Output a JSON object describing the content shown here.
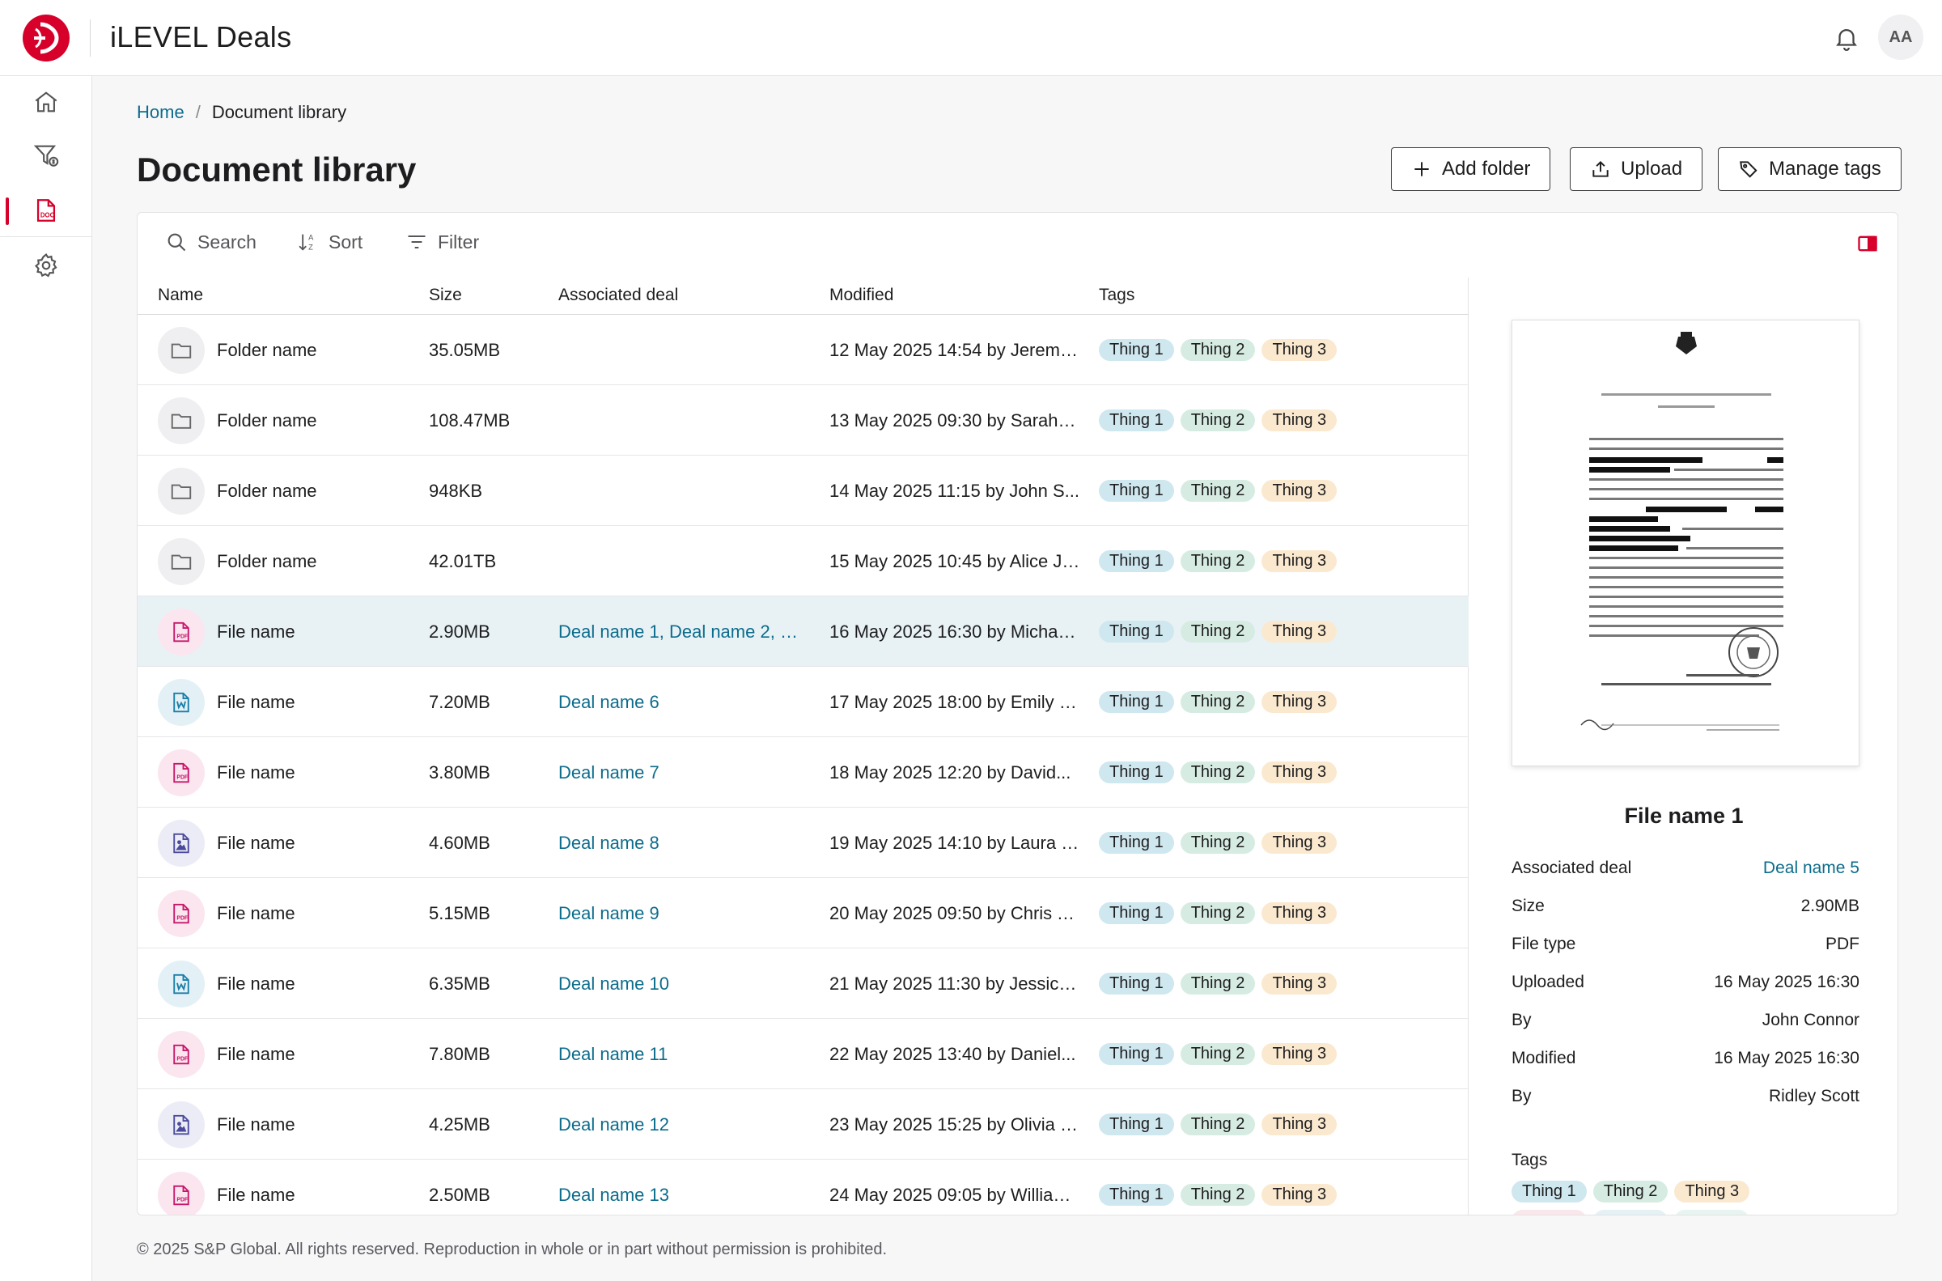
{
  "header": {
    "title": "iLEVEL Deals",
    "avatar_initials": "AA"
  },
  "breadcrumb": {
    "home": "Home",
    "separator": "/",
    "current": "Document library"
  },
  "page": {
    "title": "Document library"
  },
  "actions": {
    "add_folder": "Add folder",
    "upload": "Upload",
    "manage_tags": "Manage tags"
  },
  "toolbar": {
    "search": "Search",
    "sort": "Sort",
    "filter": "Filter"
  },
  "table": {
    "columns": {
      "name": "Name",
      "size": "Size",
      "deal": "Associated deal",
      "modified": "Modified",
      "tags": "Tags"
    },
    "rows": [
      {
        "type": "folder",
        "name": "Folder name",
        "size": "35.05MB",
        "deal": "",
        "modified": "12 May 2025 14:54 by Jeremy...",
        "tags": [
          "Thing 1",
          "Thing 2",
          "Thing 3"
        ]
      },
      {
        "type": "folder",
        "name": "Folder name",
        "size": "108.47MB",
        "deal": "",
        "modified": "13 May 2025 09:30 by Sarah C...",
        "tags": [
          "Thing 1",
          "Thing 2",
          "Thing 3"
        ]
      },
      {
        "type": "folder",
        "name": "Folder name",
        "size": "948KB",
        "deal": "",
        "modified": "14 May 2025 11:15 by John S...",
        "tags": [
          "Thing 1",
          "Thing 2",
          "Thing 3"
        ]
      },
      {
        "type": "folder",
        "name": "Folder name",
        "size": "42.01TB",
        "deal": "",
        "modified": "15 May 2025 10:45 by Alice Jo...",
        "tags": [
          "Thing 1",
          "Thing 2",
          "Thing 3"
        ]
      },
      {
        "type": "pdf",
        "name": "File name",
        "size": "2.90MB",
        "deal": "Deal name 1, Deal name 2, De...",
        "modified": "16 May 2025 16:30 by Michael...",
        "tags": [
          "Thing 1",
          "Thing 2",
          "Thing 3"
        ],
        "selected": true
      },
      {
        "type": "word",
        "name": "File name",
        "size": "7.20MB",
        "deal": "Deal name 6",
        "modified": "17 May 2025 18:00 by Emily D...",
        "tags": [
          "Thing 1",
          "Thing 2",
          "Thing 3"
        ]
      },
      {
        "type": "pdf",
        "name": "File name",
        "size": "3.80MB",
        "deal": "Deal name 7",
        "modified": "18 May 2025 12:20 by David...",
        "tags": [
          "Thing 1",
          "Thing 2",
          "Thing 3"
        ]
      },
      {
        "type": "image",
        "name": "File name",
        "size": "4.60MB",
        "deal": "Deal name 8",
        "modified": "19 May 2025 14:10 by Laura M...",
        "tags": [
          "Thing 1",
          "Thing 2",
          "Thing 3"
        ]
      },
      {
        "type": "pdf",
        "name": "File name",
        "size": "5.15MB",
        "deal": "Deal name 9",
        "modified": "20 May 2025 09:50 by Chris Ta...",
        "tags": [
          "Thing 1",
          "Thing 2",
          "Thing 3"
        ]
      },
      {
        "type": "word",
        "name": "File name",
        "size": "6.35MB",
        "deal": "Deal name 10",
        "modified": "21 May 2025 11:30 by Jessica...",
        "tags": [
          "Thing 1",
          "Thing 2",
          "Thing 3"
        ]
      },
      {
        "type": "pdf",
        "name": "File name",
        "size": "7.80MB",
        "deal": "Deal name 11",
        "modified": "22 May 2025 13:40 by Daniel...",
        "tags": [
          "Thing 1",
          "Thing 2",
          "Thing 3"
        ]
      },
      {
        "type": "image",
        "name": "File name",
        "size": "4.25MB",
        "deal": "Deal name 12",
        "modified": "23 May 2025 15:25 by Olivia G...",
        "tags": [
          "Thing 1",
          "Thing 2",
          "Thing 3"
        ]
      },
      {
        "type": "pdf",
        "name": "File name",
        "size": "2.50MB",
        "deal": "Deal name 13",
        "modified": "24 May 2025 09:05 by William...",
        "tags": [
          "Thing 1",
          "Thing 2",
          "Thing 3"
        ]
      }
    ]
  },
  "preview": {
    "title": "File name 1",
    "meta": [
      {
        "label": "Associated deal",
        "value": "Deal name 5",
        "link": true
      },
      {
        "label": "Size",
        "value": "2.90MB"
      },
      {
        "label": "File type",
        "value": "PDF"
      },
      {
        "label": "Uploaded",
        "value": "16 May 2025 16:30"
      },
      {
        "label": "By",
        "value": "John Connor"
      },
      {
        "label": "Modified",
        "value": "16 May 2025 16:30"
      },
      {
        "label": "By",
        "value": "Ridley Scott"
      }
    ],
    "tags_label": "Tags",
    "tags": [
      "Thing 1",
      "Thing 2",
      "Thing 3"
    ]
  },
  "footer": {
    "text": "© 2025 S&P Global. All rights reserved. Reproduction in whole or in part without permission is prohibited."
  },
  "colors": {
    "accent": "#d6002a",
    "link": "#0c6c8c",
    "selected_row": "#e8f2f5",
    "tag1": "#cfe7ee",
    "tag2": "#d6ece2",
    "tag3": "#fbe9cf",
    "pdf": "#c7176b",
    "word": "#1a7ea8",
    "image": "#4b4a9c"
  },
  "icons": {
    "nav": [
      "home-icon",
      "funnel-dollar-icon",
      "document-icon",
      "gear-icon"
    ]
  }
}
